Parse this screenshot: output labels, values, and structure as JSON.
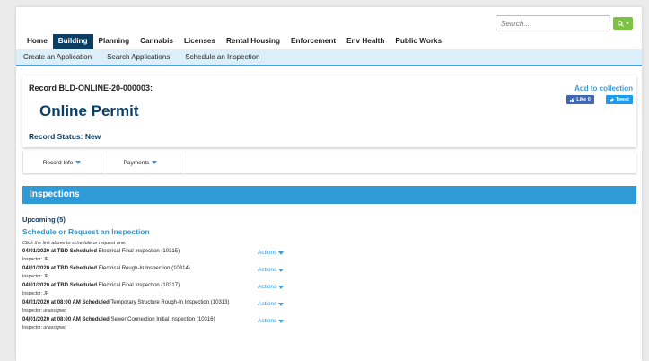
{
  "search": {
    "placeholder": "Search..."
  },
  "main_nav": [
    "Home",
    "Building",
    "Planning",
    "Cannabis",
    "Licenses",
    "Rental Housing",
    "Enforcement",
    "Env Health",
    "Public Works"
  ],
  "main_nav_active": "Building",
  "sub_nav": [
    "Create an Application",
    "Search Applications",
    "Schedule an Inspection"
  ],
  "record": {
    "id_label": "Record BLD-ONLINE-20-000003:",
    "title": "Online Permit",
    "status": "Record Status: New",
    "add_collection": "Add to collection",
    "fb_like": "Like 0",
    "tweet": "Tweet"
  },
  "record_tabs": [
    "Record Info",
    "Payments"
  ],
  "inspections": {
    "header": "Inspections",
    "upcoming": "Upcoming (5)",
    "schedule_link": "Schedule or Request an Inspection",
    "hint": "Click the link above to schedule or request one.",
    "actions_label": "Actions",
    "items": [
      {
        "when": "04/01/2020 at TBD Scheduled",
        "desc": "Electrical Final Inspection (10315)",
        "inspector_label": "Inspector:",
        "inspector": "JP"
      },
      {
        "when": "04/01/2020 at TBD Scheduled",
        "desc": "Electrical Rough-In Inspection (10314)",
        "inspector_label": "Inspector:",
        "inspector": "JP"
      },
      {
        "when": "04/01/2020 at TBD Scheduled",
        "desc": "Electrical Final Inspection (10317)",
        "inspector_label": "Inspector:",
        "inspector": "JP"
      },
      {
        "when": "04/01/2020 at 08:00 AM Scheduled",
        "desc": "Temporary Structure Rough-In Inspection (10313)",
        "inspector_label": "Inspector:",
        "inspector": "unassigned"
      },
      {
        "when": "04/01/2020 at 08:00 AM Scheduled",
        "desc": "Sewer Connection Initial Inspection (10316)",
        "inspector_label": "Inspector:",
        "inspector": "unassigned"
      }
    ]
  },
  "colors": {
    "nav_active": "#0b3e64",
    "accent": "#2e9ad6",
    "search_button": "#7cc243"
  }
}
